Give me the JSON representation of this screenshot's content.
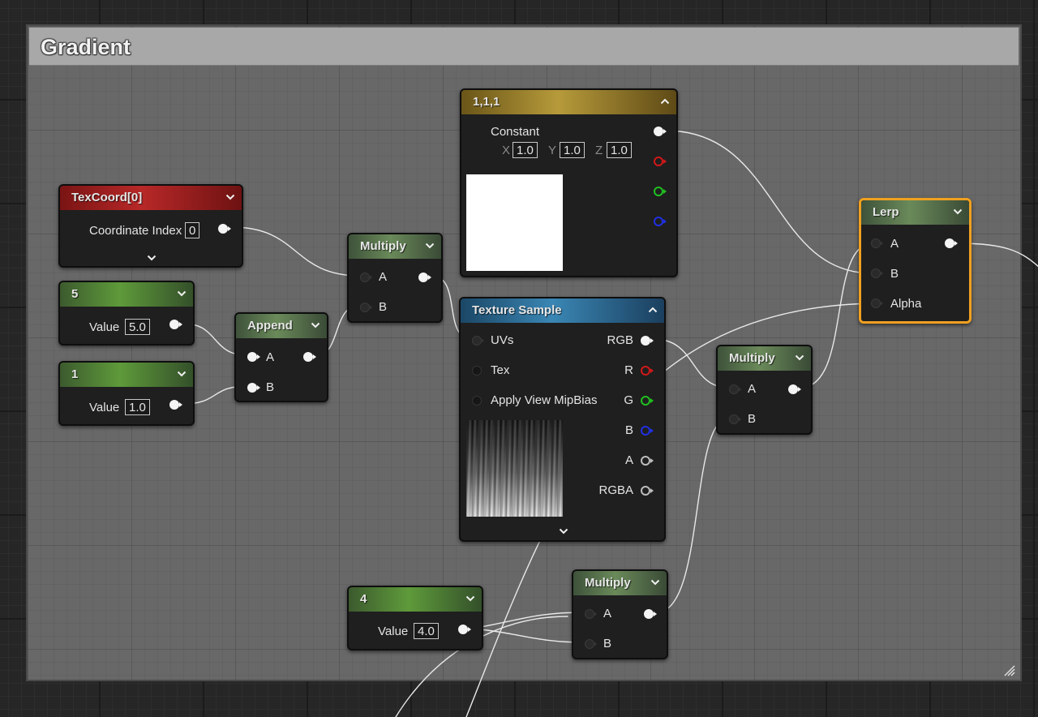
{
  "comment": {
    "title": "Gradient"
  },
  "nodes": {
    "texcoord": {
      "title": "TexCoord[0]",
      "coord_index_label": "Coordinate Index",
      "coord_index_value": "0"
    },
    "const5": {
      "title": "5",
      "value_label": "Value",
      "value": "5.0"
    },
    "const1": {
      "title": "1",
      "value_label": "Value",
      "value": "1.0"
    },
    "append": {
      "title": "Append",
      "pin_a": "A",
      "pin_b": "B"
    },
    "multiply1": {
      "title": "Multiply",
      "pin_a": "A",
      "pin_b": "B"
    },
    "constant3": {
      "title": "1,1,1",
      "output_label": "Constant",
      "x_label": "X",
      "x_value": "1.0",
      "y_label": "Y",
      "y_value": "1.0",
      "z_label": "Z",
      "z_value": "1.0",
      "swatch_color": "#ffffff"
    },
    "texture": {
      "title": "Texture Sample",
      "inputs": {
        "uvs": "UVs",
        "tex": "Tex",
        "mipbias": "Apply View MipBias"
      },
      "outputs": {
        "rgb": "RGB",
        "r": "R",
        "g": "G",
        "b": "B",
        "a": "A",
        "rgba": "RGBA"
      }
    },
    "multiply2": {
      "title": "Multiply",
      "pin_a": "A",
      "pin_b": "B"
    },
    "lerp": {
      "title": "Lerp",
      "pin_a": "A",
      "pin_b": "B",
      "pin_alpha": "Alpha"
    },
    "const4": {
      "title": "4",
      "value_label": "Value",
      "value": "4.0"
    },
    "multiply3": {
      "title": "Multiply",
      "pin_a": "A",
      "pin_b": "B"
    }
  },
  "colors": {
    "selection": "#f0a020",
    "pin_red": "#d01818",
    "pin_green": "#20c020",
    "pin_blue": "#2030e0",
    "wire": "#e8e8e8"
  },
  "icons": {
    "collapse": "chevron-down-icon",
    "expand_node": "chevron-up-icon",
    "resize": "resize-grip-icon"
  }
}
